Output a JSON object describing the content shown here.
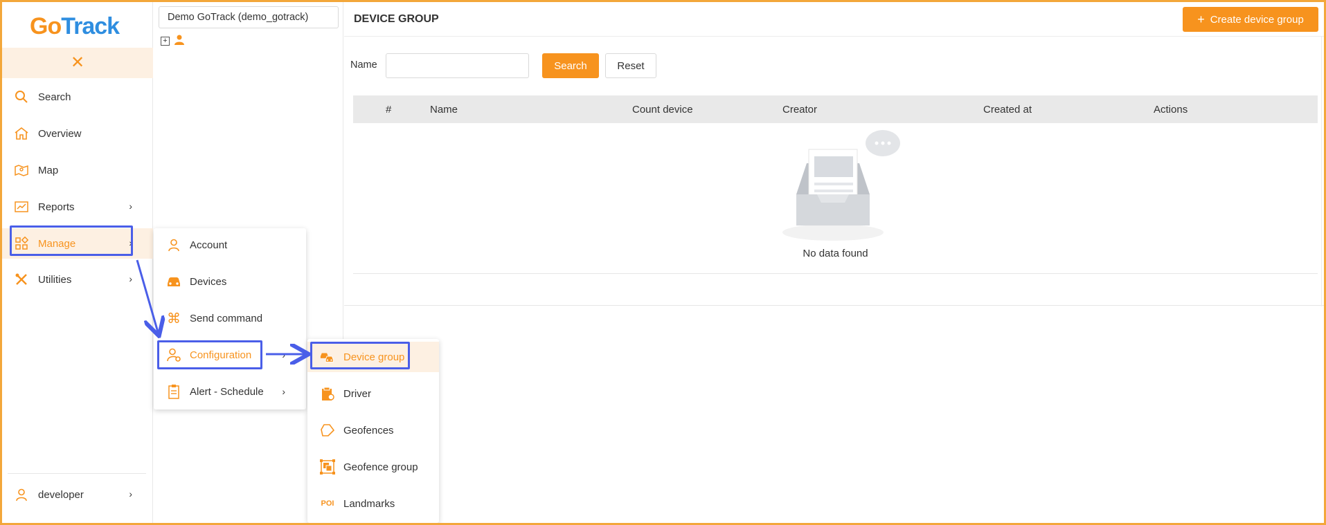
{
  "app": {
    "logo_text_go": "Go",
    "logo_text_track": "Track"
  },
  "sidebar": {
    "items": [
      {
        "label": "Search",
        "icon": "search-icon"
      },
      {
        "label": "Overview",
        "icon": "home-icon"
      },
      {
        "label": "Map",
        "icon": "map-icon"
      },
      {
        "label": "Reports",
        "icon": "chart-icon"
      },
      {
        "label": "Manage",
        "icon": "grid-icon",
        "active": true
      },
      {
        "label": "Utilities",
        "icon": "tools-icon"
      }
    ],
    "user": {
      "label": "developer",
      "icon": "user-icon"
    }
  },
  "tree": {
    "account": "Demo GoTrack (demo_gotrack)"
  },
  "main": {
    "title": "DEVICE GROUP",
    "create_button": "Create device group",
    "filter": {
      "name_label": "Name",
      "name_value": "",
      "search_label": "Search",
      "reset_label": "Reset"
    },
    "table": {
      "columns": [
        "#",
        "Name",
        "Count device",
        "Creator",
        "Created at",
        "Actions"
      ],
      "rows": [],
      "empty_text": "No data found"
    }
  },
  "manage_menu": {
    "items": [
      {
        "label": "Account",
        "icon": "user-icon"
      },
      {
        "label": "Devices",
        "icon": "car-icon"
      },
      {
        "label": "Send command",
        "icon": "command-icon"
      },
      {
        "label": "Configuration",
        "icon": "user-gear-icon",
        "selected": true
      },
      {
        "label": "Alert - Schedule",
        "icon": "clipboard-icon"
      }
    ]
  },
  "config_menu": {
    "items": [
      {
        "label": "Device group",
        "icon": "cars-icon",
        "selected": true
      },
      {
        "label": "Driver",
        "icon": "driver-icon"
      },
      {
        "label": "Geofences",
        "icon": "polygon-icon"
      },
      {
        "label": "Geofence group",
        "icon": "geofence-group-icon"
      },
      {
        "label": "Landmarks",
        "icon": "poi-icon",
        "icon_text": "POI"
      }
    ]
  },
  "colors": {
    "accent": "#f7931e",
    "logo_blue": "#2f8ee0",
    "annotation": "#4a5ee8",
    "active_bg": "#fdf0e2"
  }
}
